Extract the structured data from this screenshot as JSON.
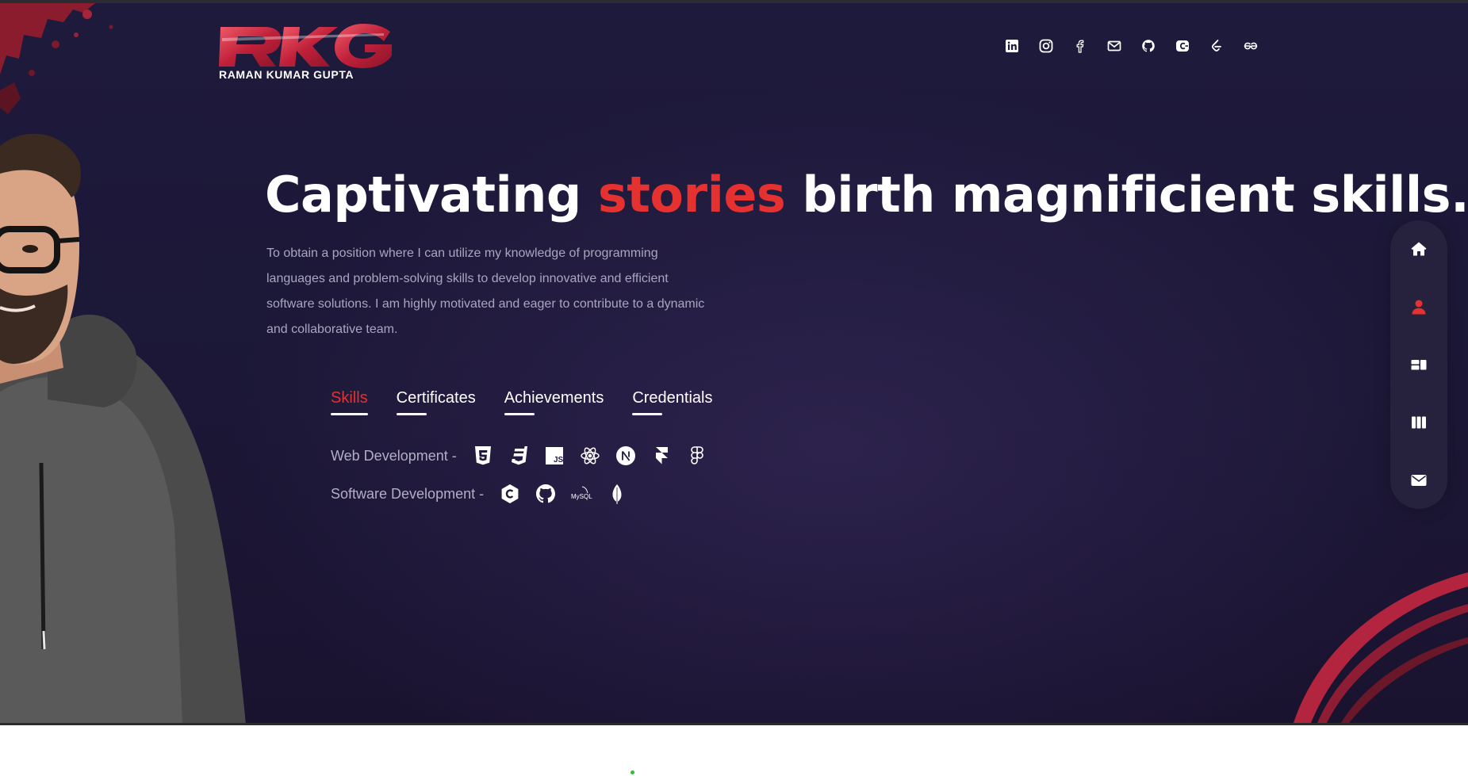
{
  "logo": {
    "mark": "RKG",
    "subtitle": "RAMAN KUMAR GUPTA"
  },
  "header": {
    "socials": [
      {
        "name": "linkedin-icon"
      },
      {
        "name": "instagram-icon"
      },
      {
        "name": "facebook-icon"
      },
      {
        "name": "mail-icon"
      },
      {
        "name": "github-icon"
      },
      {
        "name": "codechef-icon"
      },
      {
        "name": "leetcode-icon"
      },
      {
        "name": "geeksforgeeks-icon"
      }
    ]
  },
  "hero": {
    "headline_start": "Captivating ",
    "headline_accent": "stories",
    "headline_end": " birth magnificient skills.",
    "bio": "To obtain a position where I can utilize my knowledge of programming languages and problem-solving skills to develop innovative and efficient software solutions. I am highly motivated and eager to contribute to a dynamic and collaborative team."
  },
  "tabs": [
    {
      "label": "Skills",
      "active": true
    },
    {
      "label": "Certificates",
      "active": false
    },
    {
      "label": "Achievements",
      "active": false
    },
    {
      "label": "Credentials",
      "active": false
    }
  ],
  "skills": {
    "web_label": "Web Development  -",
    "web_icons": [
      "html5-icon",
      "css3-icon",
      "javascript-icon",
      "react-icon",
      "nextjs-icon",
      "framer-icon",
      "figma-icon"
    ],
    "software_label": "Software Development  -",
    "software_icons": [
      "c-language-icon",
      "github-icon",
      "mysql-icon",
      "mongodb-icon"
    ],
    "mysql_text": "MySQL"
  },
  "rail_nav": [
    {
      "name": "home-icon",
      "active": false
    },
    {
      "name": "about-user-icon",
      "active": true
    },
    {
      "name": "projects-icon",
      "active": false
    },
    {
      "name": "library-icon",
      "active": false
    },
    {
      "name": "contact-mail-icon",
      "active": false
    }
  ],
  "colors": {
    "accent": "#e5312f",
    "background": "#1e1a3c",
    "text": "#ffffff",
    "muted_text": "#a9a6be",
    "rail": "#26223e"
  }
}
